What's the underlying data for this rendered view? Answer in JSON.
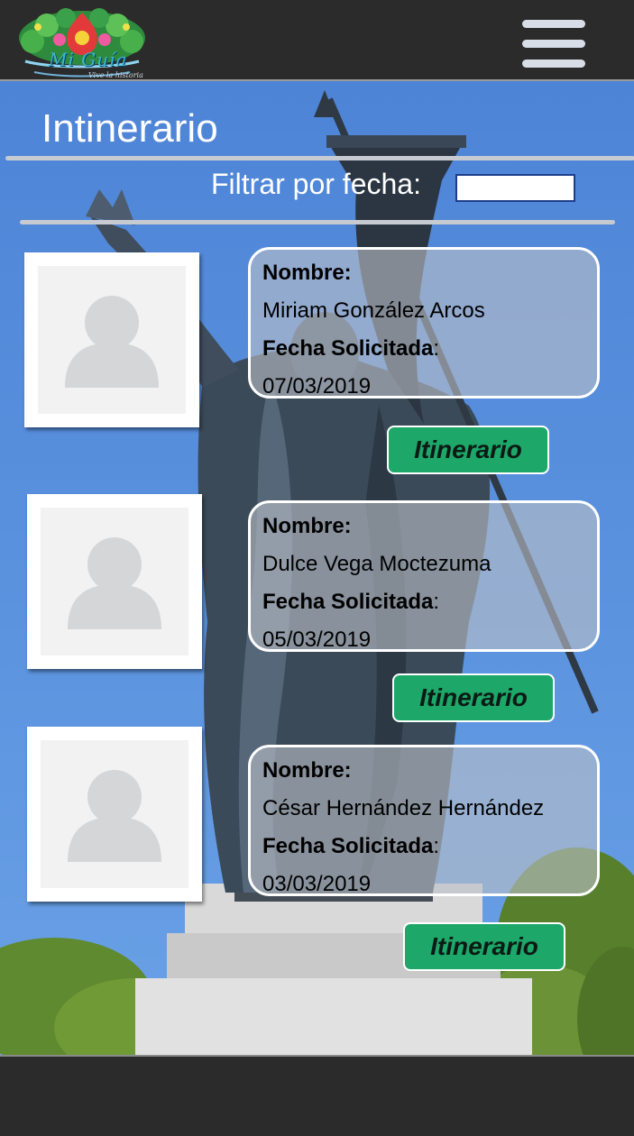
{
  "header": {
    "logo": {
      "title": "Mi Guía",
      "subtitle": "Vive la historia"
    }
  },
  "main": {
    "title": "Intinerario",
    "filter": {
      "label": "Filtrar por fecha:",
      "value": ""
    }
  },
  "requests": [
    {
      "name_label": "Nombre:",
      "name": "Miriam González Arcos",
      "date_label": "Fecha Solicitada",
      "date_colon": ":",
      "date": "07/03/2019",
      "button_label": "Itinerario"
    },
    {
      "name_label": "Nombre:",
      "name": "Dulce Vega Moctezuma",
      "date_label": "Fecha Solicitada",
      "date_colon": ":",
      "date": "05/03/2019",
      "button_label": "Itinerario"
    },
    {
      "name_label": "Nombre:",
      "name": "César Hernández Hernández",
      "date_label": "Fecha Solicitada",
      "date_colon": ":",
      "date": "03/03/2019",
      "button_label": "Itinerario"
    }
  ],
  "theme": {
    "header_bg": "#2b2b2b",
    "sky": "#5b93df",
    "button_green": "#1da769",
    "card_border": "#ffffff"
  },
  "icons": {
    "menu": "hamburger-menu-icon",
    "avatar": "user-placeholder-icon"
  }
}
